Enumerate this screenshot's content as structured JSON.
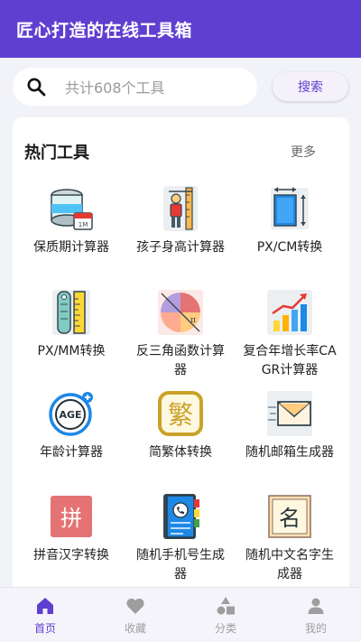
{
  "app": {
    "title": "匠心打造的在线工具箱"
  },
  "search": {
    "placeholder": "共计608个工具",
    "button_label": "搜索"
  },
  "hot": {
    "title": "热门工具",
    "more_label": "更多",
    "tools": [
      {
        "label": "保质期计算器",
        "icon": "canned-food-calendar-icon"
      },
      {
        "label": "孩子身高计算器",
        "icon": "child-height-ruler-icon"
      },
      {
        "label": "PX/CM转换",
        "icon": "px-cm-ruler-icon"
      },
      {
        "label": "PX/MM转换",
        "icon": "px-mm-ruler-icon"
      },
      {
        "label": "反三角函数计算器",
        "icon": "trigonometry-pie-icon"
      },
      {
        "label": "复合年增长率CAGR计算器",
        "icon": "growth-bar-chart-icon"
      },
      {
        "label": "年龄计算器",
        "icon": "age-badge-icon"
      },
      {
        "label": "简繁体转换",
        "icon": "traditional-character-icon"
      },
      {
        "label": "随机邮箱生成器",
        "icon": "envelope-icon"
      },
      {
        "label": "拼音汉字转换",
        "icon": "pinyin-character-icon"
      },
      {
        "label": "随机手机号生成器",
        "icon": "phone-book-icon"
      },
      {
        "label": "随机中文名字生成器",
        "icon": "chinese-name-icon"
      }
    ]
  },
  "nav": {
    "items": [
      {
        "label": "首页",
        "icon": "home-icon",
        "active": true
      },
      {
        "label": "收藏",
        "icon": "heart-icon",
        "active": false
      },
      {
        "label": "分类",
        "icon": "category-shapes-icon",
        "active": false
      },
      {
        "label": "我的",
        "icon": "user-icon",
        "active": false
      }
    ]
  },
  "colors": {
    "brand": "#5f3fd0",
    "nav_inactive": "#9e9e9e",
    "background": "#f2f3f8"
  }
}
